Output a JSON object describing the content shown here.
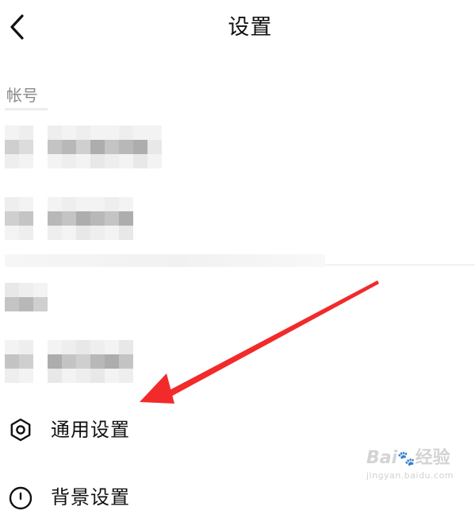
{
  "nav": {
    "title": "设置",
    "back_icon": "chevron-left-icon"
  },
  "account_section": {
    "header": "帐号"
  },
  "items": [
    {
      "label": "通用设置",
      "icon": "gear-icon"
    },
    {
      "label": "背景设置",
      "icon": "circle-icon"
    }
  ],
  "colors": {
    "annotation_arrow": "#f22a2a",
    "section_header": "#8a8a8a",
    "text": "#111111"
  },
  "watermark": {
    "brand": "Bai",
    "brand_suffix": "经验",
    "url": "jingyan.baidu.com"
  }
}
